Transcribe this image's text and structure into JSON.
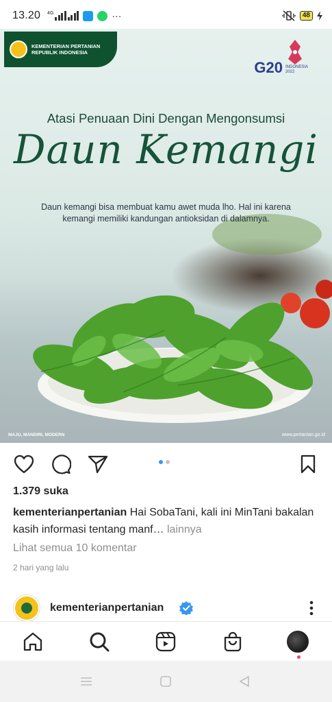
{
  "status_bar": {
    "time": "13.20",
    "network": "4G",
    "battery": "48",
    "icons": [
      "signal-icon",
      "twitter-icon",
      "whatsapp-icon",
      "more-dots-icon",
      "mute-icon",
      "battery-icon",
      "charging-icon"
    ]
  },
  "post_image": {
    "ministry_label": "KEMENTERIAN PERTANIAN\nREPUBLIK INDONESIA",
    "g20_logo_text": "G20",
    "g20_sub": "INDONESIA 2022",
    "headline": "Atasi Penuaan Dini Dengan Mengonsumsi",
    "script_title": "Daun Kemangi",
    "description": "Daun kemangi bisa membuat kamu awet muda lho. Hal ini karena kemangi memiliki kandungan antioksidan di dalamnya.",
    "slogan": "MAJU, MANDIRI, MODERN",
    "website": "www.pertanian.go.id"
  },
  "actions": {
    "icons": [
      "heart-icon",
      "comment-icon",
      "share-icon",
      "bookmark-icon"
    ],
    "carousel_total": 2,
    "carousel_active": 1
  },
  "post": {
    "likes": "1.379 suka",
    "username": "kementerianpertanian",
    "caption": "Hai SobaTani, kali ini MinTani bakalan kasih informasi tentang manf…",
    "more_label": "lainnya",
    "view_comments": "Lihat semua 10 komentar",
    "time_ago": "2 hari yang lalu"
  },
  "next_post": {
    "username": "kementerianpertanian",
    "verified": true
  },
  "bottom_nav": {
    "items": [
      "home-icon",
      "search-icon",
      "reels-icon",
      "shop-icon",
      "profile-avatar"
    ]
  },
  "colors": {
    "ig_blue": "#3797f0",
    "ministry_green": "#0f5230",
    "title_green": "#16533a",
    "notif_red": "#ed4956"
  }
}
